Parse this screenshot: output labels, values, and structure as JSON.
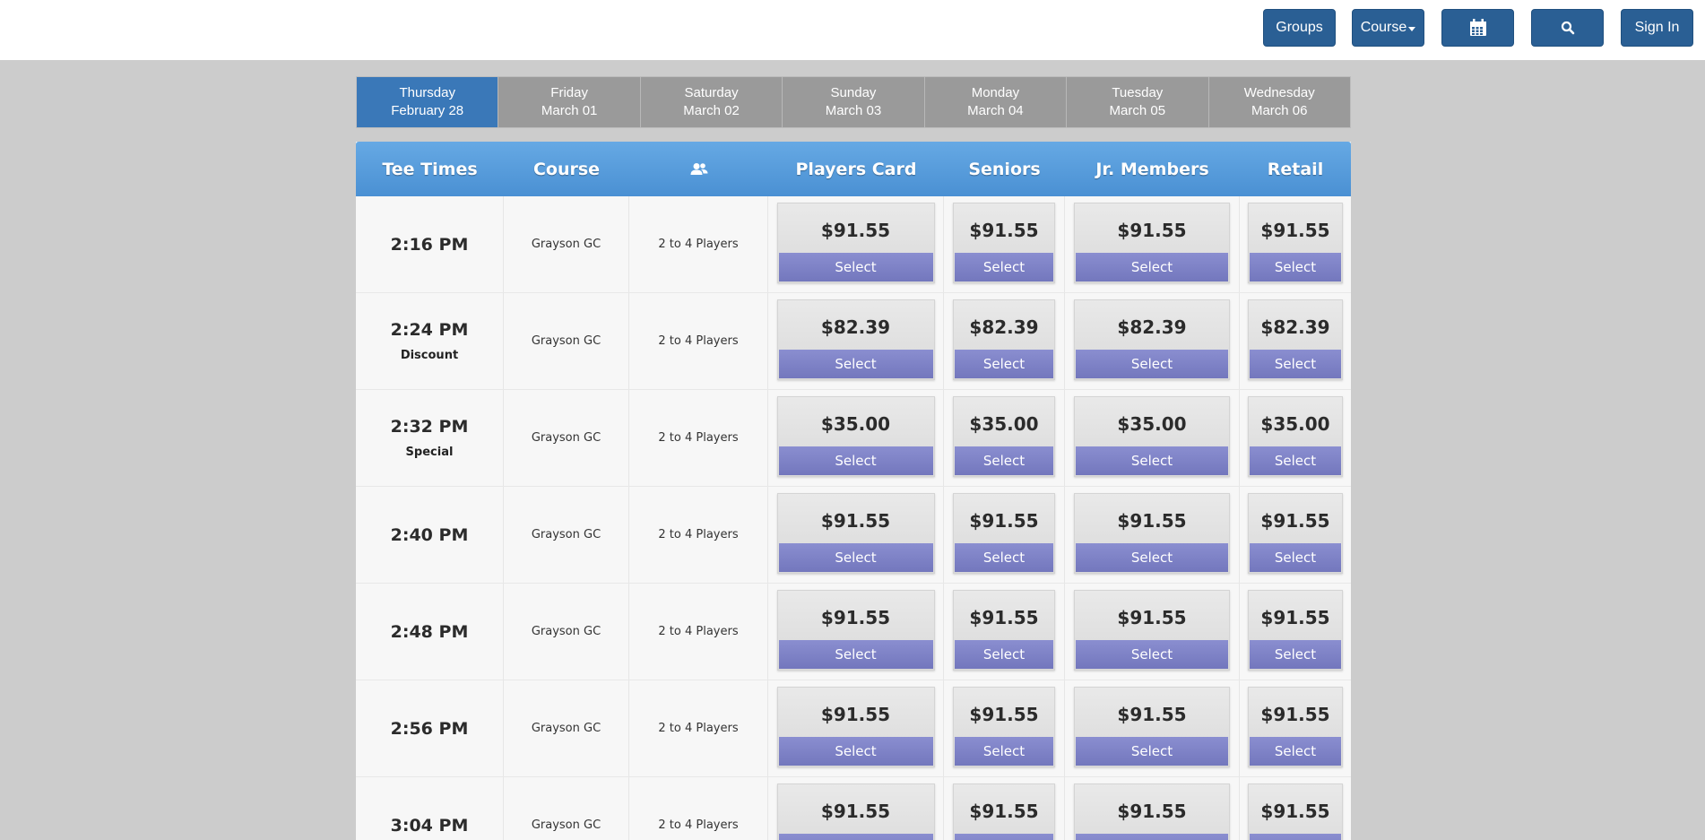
{
  "nav": {
    "groups_label": "Groups",
    "course_label": "Course",
    "signin_label": "Sign In",
    "calendar_icon": "calendar-icon",
    "search_icon": "search-icon",
    "button_color": "#2a5f94"
  },
  "days": [
    {
      "weekday": "Thursday",
      "date": "February 28",
      "active": true
    },
    {
      "weekday": "Friday",
      "date": "March 01",
      "active": false
    },
    {
      "weekday": "Saturday",
      "date": "March 02",
      "active": false
    },
    {
      "weekday": "Sunday",
      "date": "March 03",
      "active": false
    },
    {
      "weekday": "Monday",
      "date": "March 04",
      "active": false
    },
    {
      "weekday": "Tuesday",
      "date": "March 05",
      "active": false
    },
    {
      "weekday": "Wednesday",
      "date": "March 06",
      "active": false
    }
  ],
  "table": {
    "headers": {
      "tee_times": "Tee Times",
      "course": "Course",
      "players_icon": "players-icon",
      "players_card": "Players Card",
      "seniors": "Seniors",
      "jr_members": "Jr. Members",
      "retail": "Retail"
    },
    "select_label": "Select",
    "rows": [
      {
        "time": "2:16 PM",
        "tag": "",
        "course": "Grayson GC",
        "players": "2 to 4 Players",
        "prices": [
          "$91.55",
          "$91.55",
          "$91.55",
          "$91.55"
        ]
      },
      {
        "time": "2:24 PM",
        "tag": "Discount",
        "course": "Grayson GC",
        "players": "2 to 4 Players",
        "prices": [
          "$82.39",
          "$82.39",
          "$82.39",
          "$82.39"
        ]
      },
      {
        "time": "2:32 PM",
        "tag": "Special",
        "course": "Grayson GC",
        "players": "2 to 4 Players",
        "prices": [
          "$35.00",
          "$35.00",
          "$35.00",
          "$35.00"
        ]
      },
      {
        "time": "2:40 PM",
        "tag": "",
        "course": "Grayson GC",
        "players": "2 to 4 Players",
        "prices": [
          "$91.55",
          "$91.55",
          "$91.55",
          "$91.55"
        ]
      },
      {
        "time": "2:48 PM",
        "tag": "",
        "course": "Grayson GC",
        "players": "2 to 4 Players",
        "prices": [
          "$91.55",
          "$91.55",
          "$91.55",
          "$91.55"
        ]
      },
      {
        "time": "2:56 PM",
        "tag": "",
        "course": "Grayson GC",
        "players": "2 to 4 Players",
        "prices": [
          "$91.55",
          "$91.55",
          "$91.55",
          "$91.55"
        ]
      },
      {
        "time": "3:04 PM",
        "tag": "",
        "course": "Grayson GC",
        "players": "2 to 4 Players",
        "prices": [
          "$91.55",
          "$91.55",
          "$91.55",
          "$91.55"
        ]
      }
    ]
  }
}
